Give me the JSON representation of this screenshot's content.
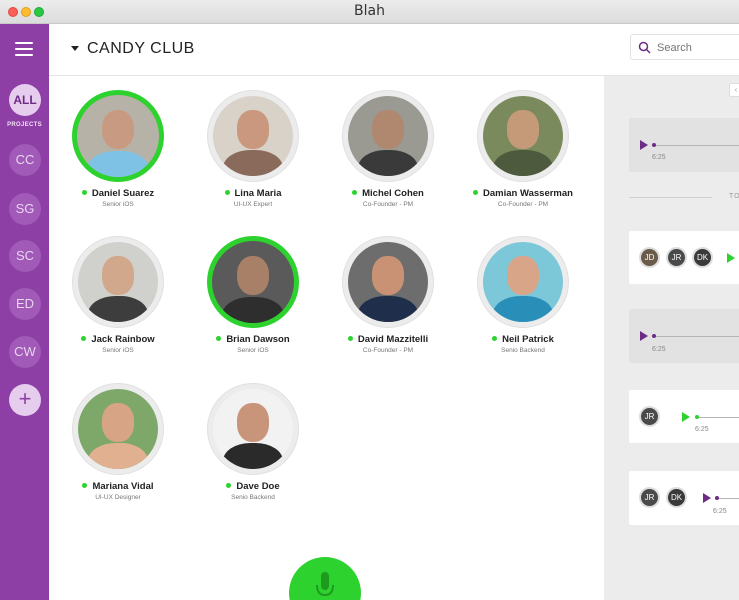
{
  "window": {
    "title": "Blah"
  },
  "sidebar": {
    "items": [
      {
        "label": "ALL",
        "caption": "PROJECTS",
        "active": true
      },
      {
        "label": "CC"
      },
      {
        "label": "SG"
      },
      {
        "label": "SC"
      },
      {
        "label": "ED"
      },
      {
        "label": "CW"
      }
    ],
    "add_label": "+"
  },
  "header": {
    "title": "CANDY CLUB",
    "search_placeholder": "Search"
  },
  "members": [
    {
      "name": "Daniel Suarez",
      "role": "Senior iOS",
      "ring": "online"
    },
    {
      "name": "Lina Maria",
      "role": "UI-UX Expert",
      "ring": "none"
    },
    {
      "name": "Michel Cohen",
      "role": "Co-Founder - PM",
      "ring": "none"
    },
    {
      "name": "Damian Wasserman",
      "role": "Co-Founder - PM",
      "ring": "none"
    },
    {
      "name": "Jack Rainbow",
      "role": "Senior iOS",
      "ring": "none"
    },
    {
      "name": "Brian Dawson",
      "role": "Senior iOS",
      "ring": "online"
    },
    {
      "name": "David Mazzitelli",
      "role": "Co-Founder - PM",
      "ring": "none"
    },
    {
      "name": "Neil Patrick",
      "role": "Senio Backend",
      "ring": "none"
    },
    {
      "name": "Mariana Vidal",
      "role": "UI-UX Designer",
      "ring": "none"
    },
    {
      "name": "Dave Doe",
      "role": "Senio Backend",
      "ring": "none"
    }
  ],
  "feed": {
    "divider_label": "TO",
    "messages": [
      {
        "time": "6:25"
      },
      {
        "avatars": [
          "JD",
          "JR",
          "DK"
        ]
      },
      {
        "time": "6:25"
      },
      {
        "avatars": [
          "JR"
        ],
        "time": "6:25"
      },
      {
        "avatars": [
          "JR",
          "DK"
        ],
        "time": "6:25"
      }
    ]
  },
  "colors": {
    "sidebar": "#8d3fa5",
    "accent_green": "#2ed22e",
    "play_purple": "#6d2c86",
    "feed_bg": "#ececec"
  }
}
